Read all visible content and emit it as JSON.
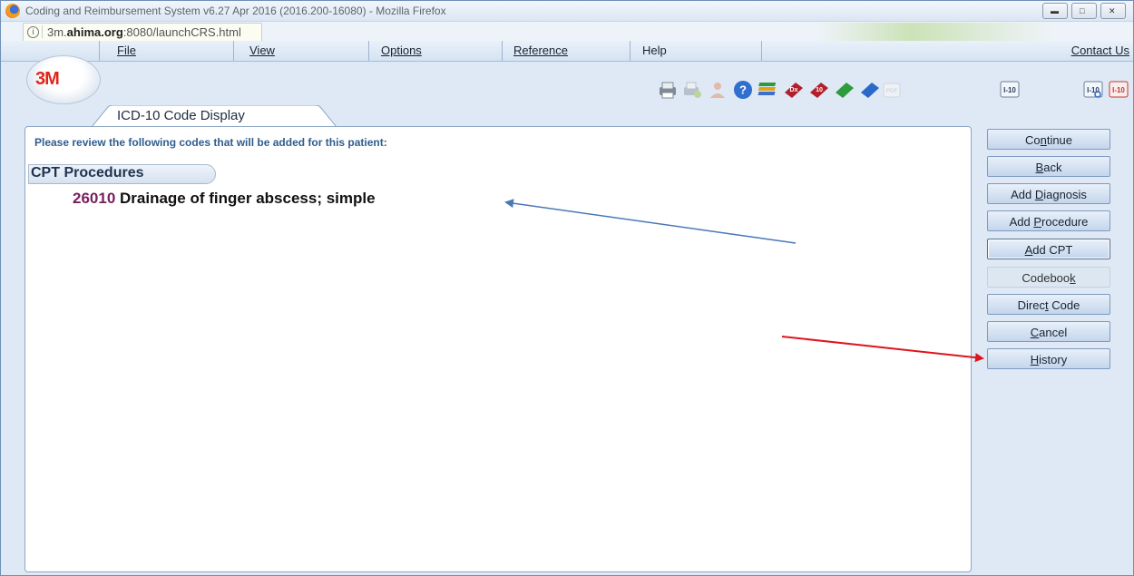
{
  "window": {
    "title": "Coding and Reimbursement System v6.27 Apr 2016 (2016.200-16080) - Mozilla Firefox"
  },
  "url": {
    "prefix": "3m.",
    "host": "ahima.org",
    "suffix": ":8080/launchCRS.html"
  },
  "menu": {
    "file": "File",
    "view": "View",
    "options": "Options",
    "reference": "Reference",
    "help": "Help",
    "contact": "Contact Us"
  },
  "logo": "3M",
  "toolbar_icons": [
    "print-icon",
    "print-preview-icon",
    "person-icon",
    "help-icon",
    "books-icon",
    "dx-book-icon",
    "icd10-book-icon",
    "green-book-icon",
    "blue-book-icon",
    "pdf-icon",
    "i10-icon",
    "i10-search-icon",
    "i10-red-icon"
  ],
  "toolbar_labels": {
    "i10a": "I-10",
    "i10b": "I-10",
    "i10c": "I-10",
    "dx": "Dx",
    "ten": "10",
    "pdf": "PDF"
  },
  "tab": {
    "label": "ICD-10 Code Display"
  },
  "content": {
    "instruction": "Please review the following codes that will be added for this patient:",
    "section_header": "CPT Procedures",
    "code": "26010",
    "description": "Drainage of finger abscess; simple"
  },
  "buttons": {
    "continue": {
      "pre": "Co",
      "u": "n",
      "post": "tinue"
    },
    "back": {
      "pre": "",
      "u": "B",
      "post": "ack"
    },
    "add_diagnosis": {
      "pre": "Add ",
      "u": "D",
      "post": "iagnosis"
    },
    "add_procedure": {
      "pre": "Add ",
      "u": "P",
      "post": "rocedure"
    },
    "add_cpt": {
      "pre": "",
      "u": "A",
      "post": "dd CPT"
    },
    "codebook": {
      "pre": "Codeboo",
      "u": "k",
      "post": ""
    },
    "direct_code": {
      "pre": "Direc",
      "u": "t",
      "post": " Code"
    },
    "cancel": {
      "pre": "",
      "u": "C",
      "post": "ancel"
    },
    "history": {
      "pre": "",
      "u": "H",
      "post": "istory"
    }
  },
  "colors": {
    "annotation_blue": "#4a78b5",
    "annotation_red": "#e0141e",
    "code_number": "#7a1f5c",
    "instruction_text": "#2f5d8e"
  }
}
